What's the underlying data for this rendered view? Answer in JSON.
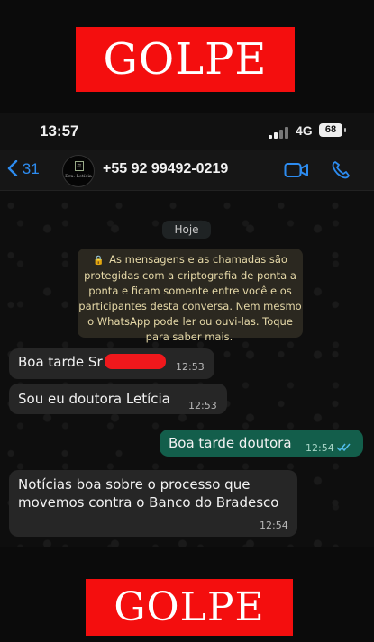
{
  "banner_top": "GOLPE",
  "banner_bottom": "GOLPE",
  "status": {
    "time": "13:57",
    "network": "4G",
    "battery": "68"
  },
  "header": {
    "back_count": "31",
    "contact_number": "+55 92 99492-0219",
    "avatar_text": "Dra. Letícia"
  },
  "chat": {
    "date_label": "Hoje",
    "encryption_notice": "As mensagens e as chamadas são protegidas com a criptografia de ponta a ponta e ficam somente entre você e os participantes desta conversa. Nem mesmo o WhatsApp pode ler ou ouvi-las. Toque para saber mais.",
    "messages": [
      {
        "direction": "in",
        "text": "Boa tarde Sr",
        "time": "12:53",
        "redacted": true
      },
      {
        "direction": "in",
        "text": "Sou eu doutora Letícia",
        "time": "12:53"
      },
      {
        "direction": "out",
        "text": "Boa tarde doutora",
        "time": "12:54",
        "status": "read"
      },
      {
        "direction": "in",
        "text": "Notícias boa sobre o processo que movemos contra o Banco do Bradesco",
        "time": "12:54"
      }
    ]
  },
  "colors": {
    "banner": "#f40e0e",
    "accent_blue": "#2d8cf0",
    "outgoing_bubble": "#135e4b",
    "incoming_bubble": "#262626"
  }
}
